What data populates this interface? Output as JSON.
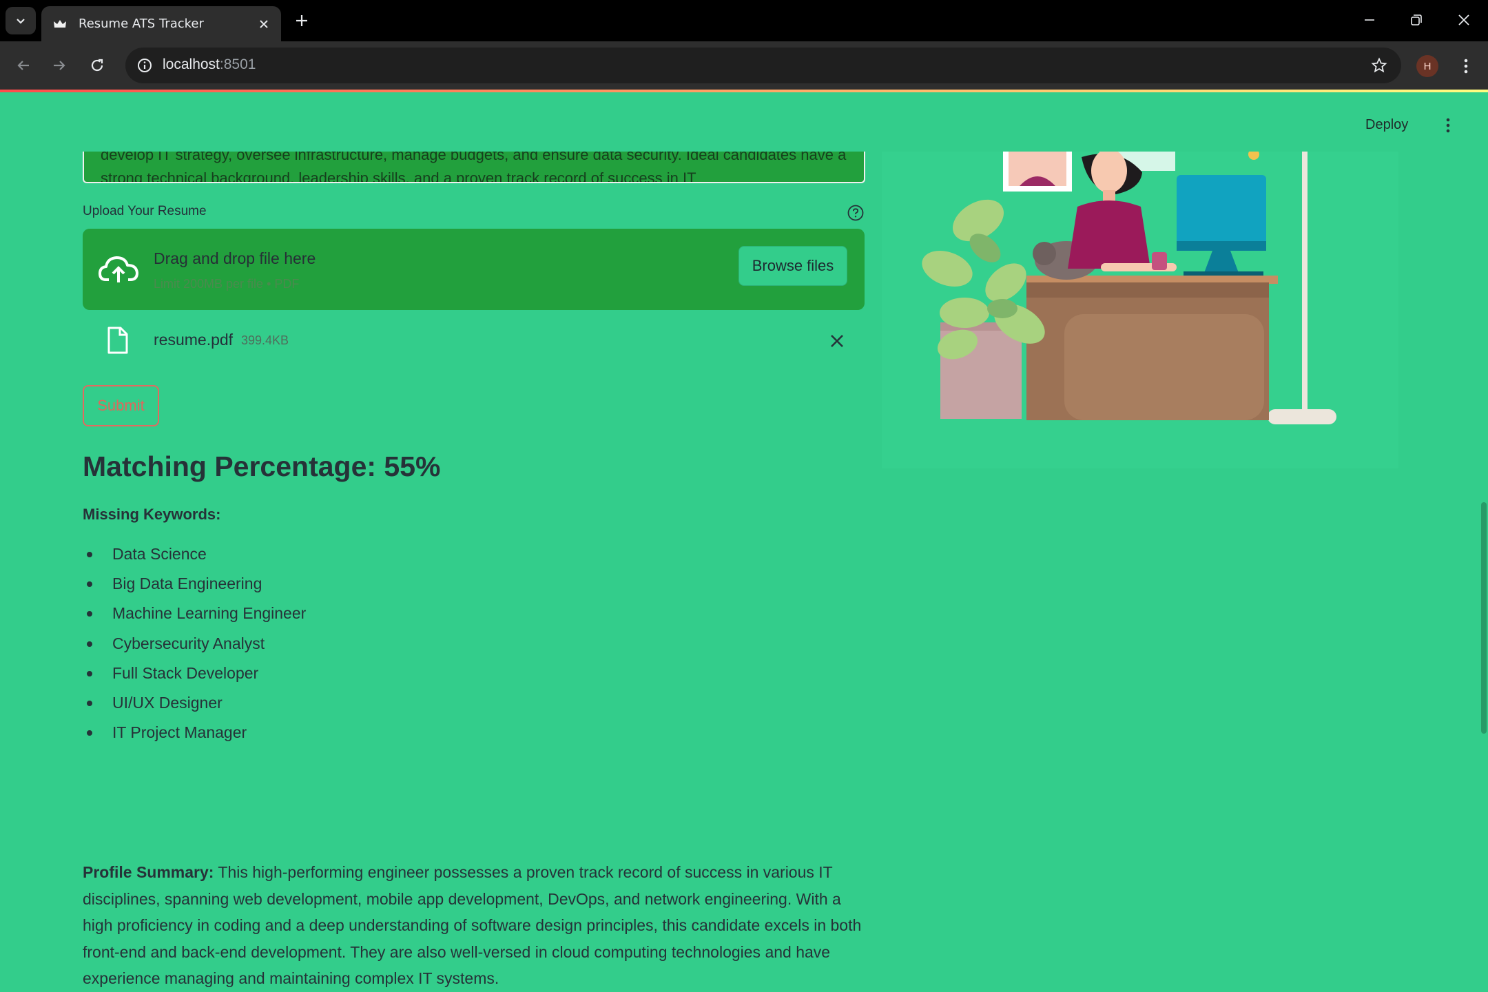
{
  "browser": {
    "tab_title": "Resume ATS Tracker",
    "url_host": "localhost",
    "url_port": ":8501",
    "profile_initial": "H"
  },
  "app": {
    "deploy_label": "Deploy",
    "job_description_visible": "develop IT strategy, oversee infrastructure, manage budgets, and ensure data security. Ideal candidates have a strong technical background, leadership skills, and a proven track record of success in IT",
    "upload_label": "Upload Your Resume",
    "dropzone": {
      "title": "Drag and drop file here",
      "limit": "Limit 200MB per file • PDF",
      "browse_label": "Browse files"
    },
    "uploaded_file": {
      "name": "resume.pdf",
      "size": "399.4KB"
    },
    "submit_label": "Submit",
    "match_heading": "Matching Percentage: 55%",
    "missing_label": "Missing Keywords:",
    "missing_keywords": [
      "Data Science",
      "Big Data Engineering",
      "Machine Learning Engineer",
      "Cybersecurity Analyst",
      "Full Stack Developer",
      "UI/UX Designer",
      "IT Project Manager"
    ],
    "profile_summary_label": "Profile Summary:",
    "profile_summary_text": " This high-performing engineer possesses a proven track record of success in various IT disciplines, spanning web development, mobile app development, DevOps, and network engineering. With a high proficiency in coding and a deep understanding of software design principles, this candidate excels in both front-end and back-end development. They are also well-versed in cloud computing technologies and have experience managing and maintaining complex IT systems."
  },
  "colors": {
    "app_background": "#33cd8b",
    "widget_background": "#22a03d",
    "submit_accent": "#e26a60"
  },
  "icons": [
    "tab-list-icon",
    "crown-favicon-icon",
    "close-icon",
    "plus-icon",
    "minimize-icon",
    "restore-icon",
    "back-icon",
    "forward-icon",
    "reload-icon",
    "site-info-icon",
    "star-icon",
    "kebab-menu-icon",
    "help-icon",
    "cloud-upload-icon",
    "file-icon"
  ]
}
